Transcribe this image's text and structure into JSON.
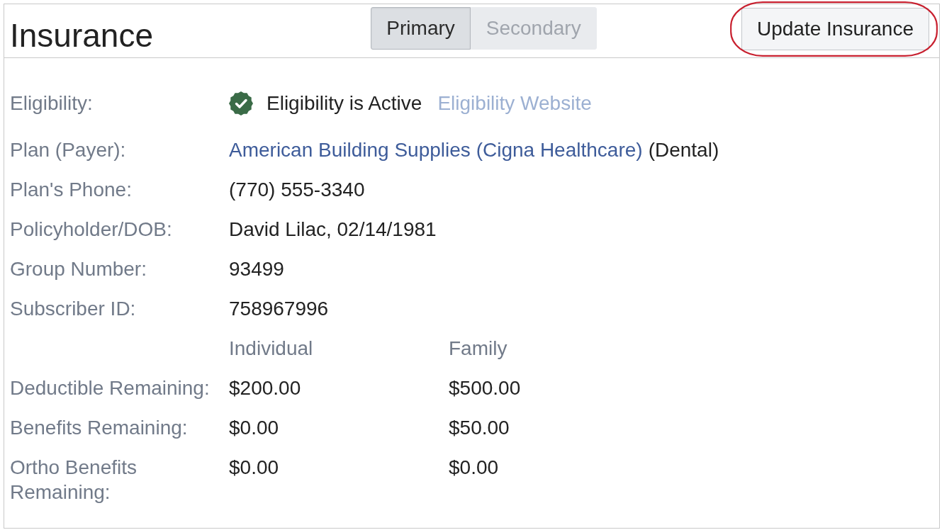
{
  "header": {
    "title": "Insurance",
    "tabs": [
      {
        "label": "Primary",
        "selected": true
      },
      {
        "label": "Secondary",
        "selected": false
      }
    ],
    "update_button": {
      "label": "Update Insurance",
      "highlighted": true
    }
  },
  "eligibility": {
    "label": "Eligibility:",
    "active": true,
    "status": "Eligibility is Active",
    "link": "Eligibility Website"
  },
  "fields": [
    {
      "label": "Plan (Payer):",
      "link": "American Building Supplies (Cigna Healthcare)",
      "value": "(Dental)"
    },
    {
      "label": "Plan's Phone:",
      "value": "(770) 555-3340"
    },
    {
      "label": "Policyholder/DOB:",
      "value": "David Lilac, 02/14/1981"
    },
    {
      "label": "Group Number:",
      "value": "93499"
    },
    {
      "label": "Subscriber ID:",
      "value": "758967996"
    }
  ],
  "benefits": {
    "columns": [
      "Individual",
      "Family"
    ],
    "rows": [
      {
        "label": "Deductible Remaining:",
        "values": [
          "$200.00",
          "$500.00"
        ]
      },
      {
        "label": "Benefits Remaining:",
        "values": [
          "$0.00",
          "$50.00"
        ]
      },
      {
        "label": "Ortho Benefits Remaining:",
        "values": [
          "$0.00",
          "$0.00"
        ]
      }
    ]
  }
}
